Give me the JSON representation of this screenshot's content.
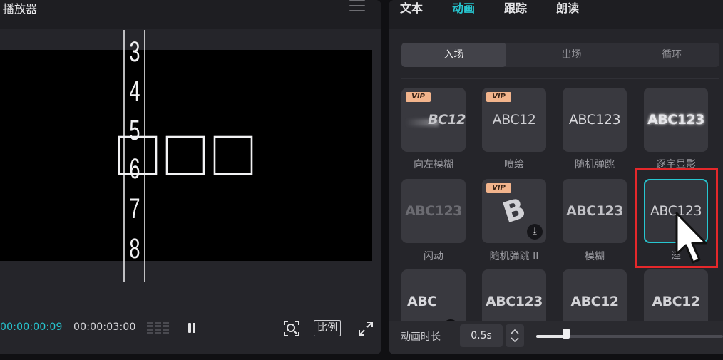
{
  "player": {
    "title": "播放器",
    "ruler_numbers": [
      "3",
      "4",
      "5",
      "6",
      "7",
      "8"
    ],
    "current_time": "00:00:00:09",
    "total_time": "00:00:03:00",
    "ratio_label": "比例"
  },
  "right_panel": {
    "tabs": [
      {
        "label": "文本",
        "active": false
      },
      {
        "label": "动画",
        "active": true
      },
      {
        "label": "跟踪",
        "active": false
      },
      {
        "label": "朗读",
        "active": false
      }
    ],
    "segments": [
      {
        "label": "入场",
        "active": true
      },
      {
        "label": "出场",
        "active": false
      },
      {
        "label": "循环",
        "active": false
      }
    ],
    "vip_label": "VIP",
    "animations": [
      {
        "label": "向左模糊",
        "preview": "BC12",
        "vip": true
      },
      {
        "label": "喷绘",
        "preview": "ABC12",
        "vip": true
      },
      {
        "label": "随机弹跳",
        "preview": "ABC123",
        "vip": false
      },
      {
        "label": "逐字显影",
        "preview": "ABC123",
        "vip": false
      },
      {
        "label": "闪动",
        "preview": "ABC123",
        "vip": false
      },
      {
        "label": "随机弹跳 II",
        "preview": "B",
        "vip": true,
        "download": true
      },
      {
        "label": "模糊",
        "preview": "ABC123",
        "vip": false
      },
      {
        "label": "泽",
        "preview": "ABC123",
        "vip": false,
        "selected": true
      },
      {
        "label": "",
        "preview": "ABC",
        "vip": false
      },
      {
        "label": "",
        "preview": "ABC123",
        "vip": false
      },
      {
        "label": "",
        "preview": "ABC12",
        "vip": false
      },
      {
        "label": "",
        "preview": "ABC12",
        "vip": false
      }
    ],
    "duration": {
      "label": "动画时长",
      "value": "0.5s",
      "fraction": 0.16
    }
  },
  "colors": {
    "accent": "#27c6d0",
    "highlight": "#e5282b",
    "vip": "#f2b48c"
  },
  "icons": [
    "menu-icon",
    "waveform-icon",
    "pause-icon",
    "zoom-fit-icon",
    "fullscreen-icon",
    "download-icon",
    "chevron-up-down-icon",
    "mouse-cursor-icon"
  ]
}
